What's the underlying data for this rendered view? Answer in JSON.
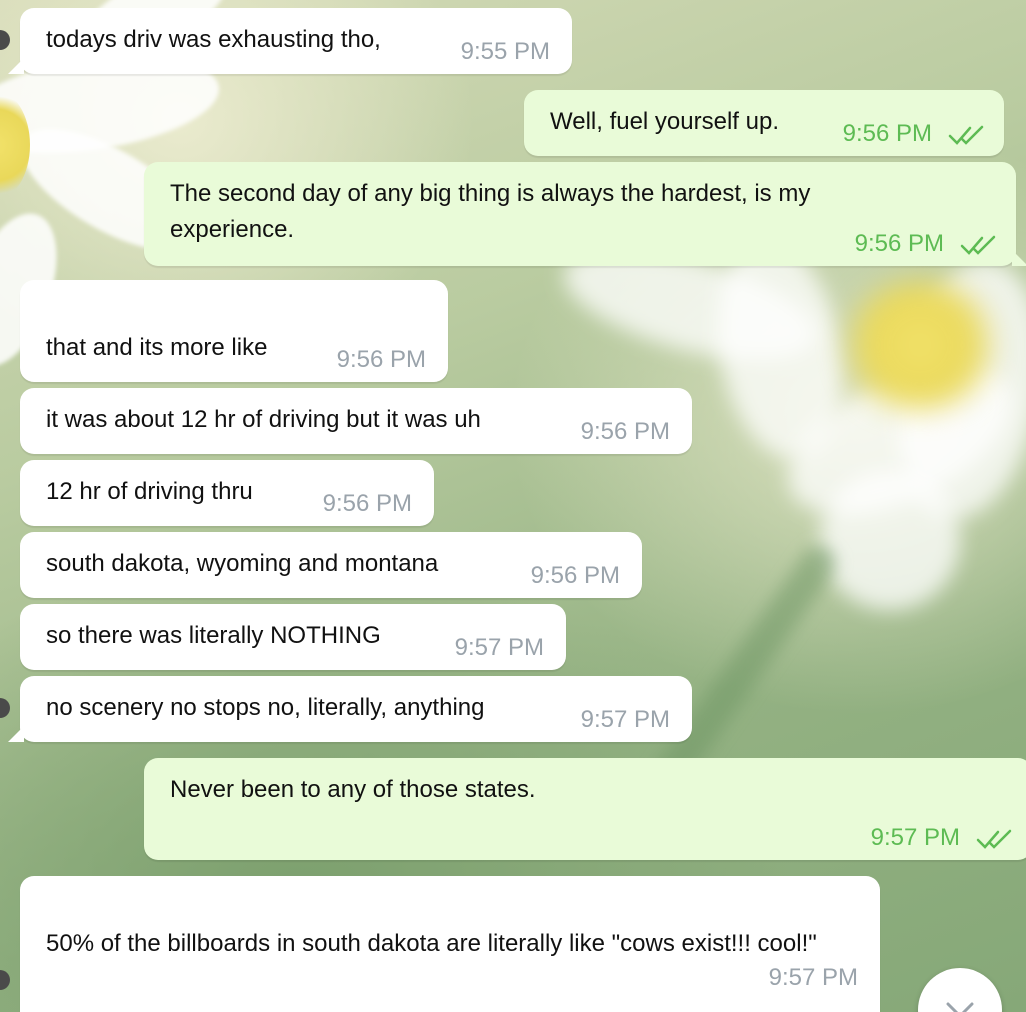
{
  "messages": [
    {
      "dir": "in",
      "text": "todays driv was exhausting tho,",
      "time": "9:55 PM"
    },
    {
      "dir": "out",
      "text": "Well, fuel yourself up.",
      "time": "9:56 PM",
      "status": "read"
    },
    {
      "dir": "out",
      "text": "The second day of any big thing is always the hardest, is my experience.",
      "time": "9:56 PM",
      "status": "read"
    },
    {
      "dir": "in",
      "text": "that and its more like",
      "time": "9:56 PM"
    },
    {
      "dir": "in",
      "text": "it was about 12 hr of driving but it was uh",
      "time": "9:56 PM"
    },
    {
      "dir": "in",
      "text": "12 hr of driving thru",
      "time": "9:56 PM"
    },
    {
      "dir": "in",
      "text": "south dakota, wyoming and montana",
      "time": "9:56 PM"
    },
    {
      "dir": "in",
      "text": "so there was literally NOTHING",
      "time": "9:57 PM"
    },
    {
      "dir": "in",
      "text": "no scenery no stops no, literally, anything",
      "time": "9:57 PM"
    },
    {
      "dir": "out",
      "text": "Never been to any of those states.",
      "time": "9:57 PM",
      "status": "read"
    },
    {
      "dir": "in",
      "text": "50% of the billboards in south dakota are literally like \"cows exist!!! cool!\"",
      "time": "9:57 PM"
    }
  ],
  "icons": {
    "read_status": "double-check-icon",
    "scroll_down": "chevron-down-icon"
  },
  "colors": {
    "incoming_bubble": "#ffffff",
    "outgoing_bubble": "#e9fbd8",
    "outgoing_time": "#5dbb53",
    "incoming_time": "#9aa3ab"
  }
}
